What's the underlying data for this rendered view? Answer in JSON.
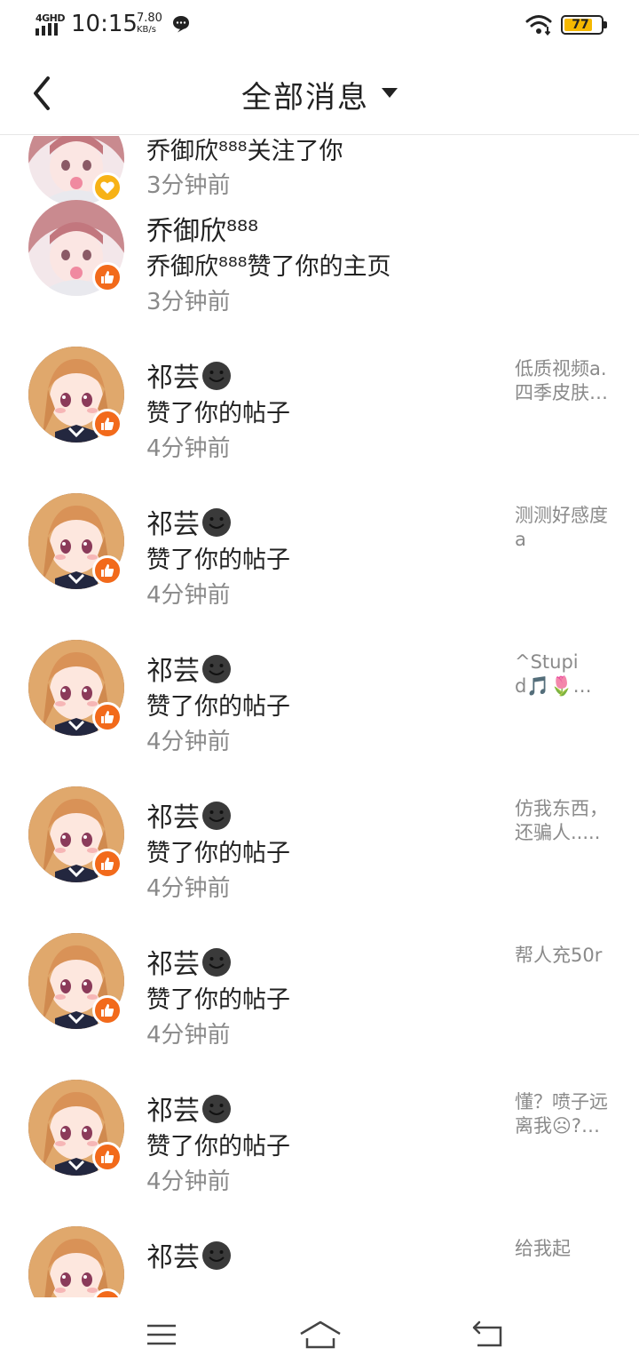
{
  "status_bar": {
    "network": "4GHD",
    "time": "10:15",
    "speed_value": "7.80",
    "speed_unit": "KB/s",
    "battery": "77",
    "battery_color": "#f5b800"
  },
  "header": {
    "title": "全部消息"
  },
  "colors": {
    "like_badge": "#f26a1b",
    "follow_badge": "#f7b216",
    "secondary_text": "#8a8a8a"
  },
  "messages": [
    {
      "name": "",
      "desc": "乔御欣⁸⁸⁸关注了你",
      "time": "3分钟前",
      "preview": "",
      "badge": "heart-icon",
      "avatar": "pink"
    },
    {
      "name": "乔御欣⁸⁸⁸",
      "desc": "乔御欣⁸⁸⁸赞了你的主页",
      "time": "3分钟前",
      "preview": "",
      "badge": "thumbs-up-icon",
      "avatar": "pink"
    },
    {
      "name": "祁芸",
      "desc": "赞了你的帖子",
      "time": "4分钟前",
      "preview": "低质视频a.四季皮肤…",
      "badge": "thumbs-up-icon",
      "avatar": "blonde"
    },
    {
      "name": "祁芸",
      "desc": "赞了你的帖子",
      "time": "4分钟前",
      "preview": "测测好感度a",
      "badge": "thumbs-up-icon",
      "avatar": "blonde"
    },
    {
      "name": "祁芸",
      "desc": "赞了你的帖子",
      "time": "4分钟前",
      "preview": "^Stupid🎵🌷…",
      "badge": "thumbs-up-icon",
      "avatar": "blonde"
    },
    {
      "name": "祁芸",
      "desc": "赞了你的帖子",
      "time": "4分钟前",
      "preview": "仿我东西，还骗人.....",
      "badge": "thumbs-up-icon",
      "avatar": "blonde"
    },
    {
      "name": "祁芸",
      "desc": "赞了你的帖子",
      "time": "4分钟前",
      "preview": "帮人充50r",
      "badge": "thumbs-up-icon",
      "avatar": "blonde"
    },
    {
      "name": "祁芸",
      "desc": "赞了你的帖子",
      "time": "4分钟前",
      "preview": "懂？喷子远离我☹?…",
      "badge": "thumbs-up-icon",
      "avatar": "blonde"
    },
    {
      "name": "祁芸",
      "desc": "",
      "time": "",
      "preview": "给我起",
      "badge": "thumbs-up-icon",
      "avatar": "blonde"
    }
  ]
}
